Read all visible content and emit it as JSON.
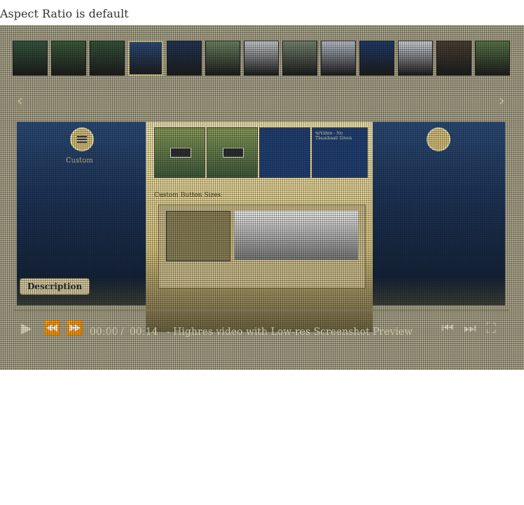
{
  "page": {
    "heading": "Aspect Ratio is default"
  },
  "gallery": {
    "thumbnails": [
      {
        "name": "thumb-forest-dialog-1",
        "color": "#355a3e"
      },
      {
        "name": "thumb-forest-dialog-2",
        "color": "#3b5f3c"
      },
      {
        "name": "thumb-forest-dialog-3",
        "color": "#35573a"
      },
      {
        "name": "thumb-blue-ui",
        "color": "#2c4d80"
      },
      {
        "name": "thumb-blue-dark",
        "color": "#1f3658"
      },
      {
        "name": "thumb-river",
        "color": "#6f8a63"
      },
      {
        "name": "thumb-document",
        "color": "#cfd3d6"
      },
      {
        "name": "thumb-mountain",
        "color": "#7b8b74"
      },
      {
        "name": "thumb-table",
        "color": "#bfc8d4"
      },
      {
        "name": "thumb-spreadsheet",
        "color": "#1d3c6e"
      },
      {
        "name": "thumb-text-doc",
        "color": "#d6dbe1"
      },
      {
        "name": "thumb-sunset",
        "color": "#4a4132"
      },
      {
        "name": "thumb-landscape",
        "color": "#5b7c4a"
      }
    ],
    "selected_index": 3,
    "prev_arrow": "‹",
    "next_arrow": "›",
    "slide": {
      "menu_label": "Custom",
      "inner": {
        "heading": "Custom Button Sizes:",
        "video_caption": "w/Video - No Thumbnail Given"
      }
    },
    "description_button": "Description",
    "player": {
      "play_icon": "▶",
      "rewind_icon": "⏪",
      "forward_icon": "⏩",
      "current_time": "00:00",
      "separator": "/",
      "duration": "00:14",
      "title": "- Highres video with Low-res Screenshot Preview",
      "prev_icon": "⏮",
      "next_icon": "⏭",
      "fullscreen_icon": "⛶"
    }
  }
}
